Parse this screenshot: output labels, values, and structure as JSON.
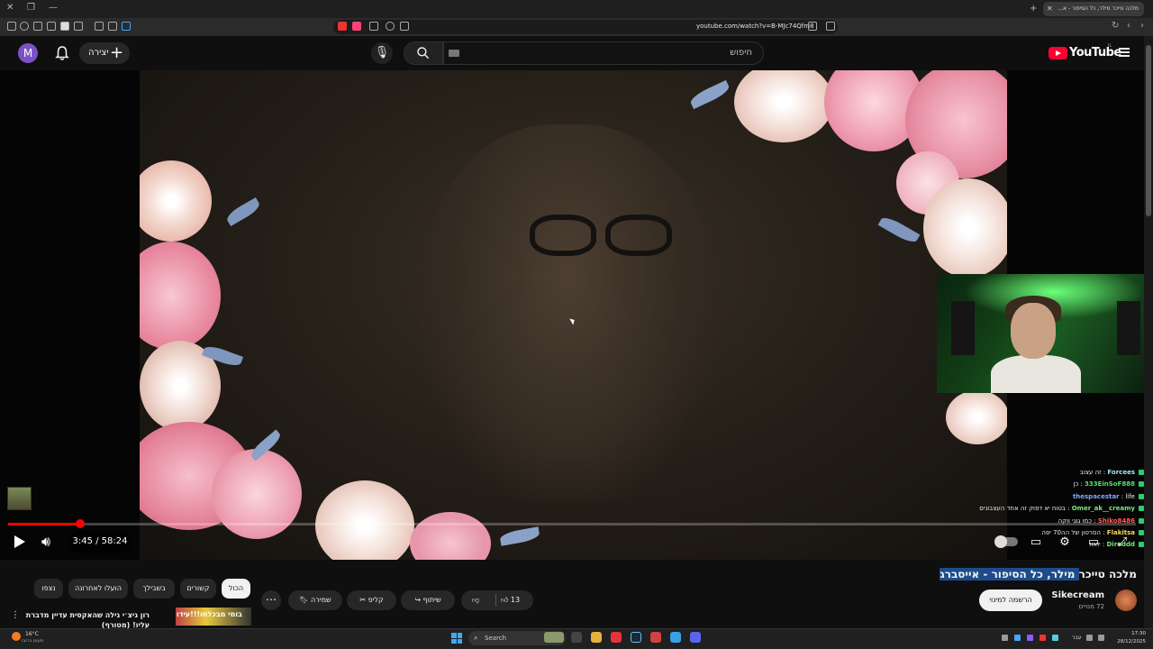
{
  "browser": {
    "active_tab_title": "מלכה טייכר מילר, כל הסיפור - א...",
    "url": "youtube.com/watch?v=B-MJc74Qfm8"
  },
  "header": {
    "avatar_letter": "M",
    "create_label": "יצירה",
    "search_placeholder": "חיפוש",
    "logo_text": "YouTube",
    "logo_country": "IL"
  },
  "player": {
    "time": "3:45 / 58:24",
    "progress": 0.064,
    "chat": [
      {
        "user": "Forcees",
        "message": "זה עצוב"
      },
      {
        "user": "333EinSoF888",
        "message": "כן"
      },
      {
        "user": "thespacestar",
        "message": "life"
      },
      {
        "user": "Omer_ak__creamy",
        "message": "בטוח יא דפוק זה אחד העצבונים"
      },
      {
        "user": "Shiko8486",
        "message": "כמו גוגי ווקה"
      },
      {
        "user": "Flakitsa",
        "message": "הסרטון של הה70 יפה"
      },
      {
        "user": "Diroddd",
        "message": "יואוו"
      }
    ]
  },
  "video": {
    "title_prefix": "מלכה טייכר",
    "title_highlight": " מילר, כל הסיפור - אייסברג",
    "channel_name": "Sikecream",
    "subscribers": "72 מנויים",
    "subscribe_label": "הרשמה למינוי",
    "like_count": "13",
    "share_label": "שיתוף",
    "clip_label": "קליפ",
    "save_label": "שמירה"
  },
  "chips": [
    "הכול",
    "קשורים",
    "בשבילך",
    "הועלו לאחרונה",
    "נצפו"
  ],
  "recommendation": {
    "thumb_text": "בומי מבכלחו!!!עידו",
    "title": "רון גיצ׳י גילה שהאקסית עדיין מדברת עליו! (מטורף)"
  },
  "taskbar": {
    "temperature": "16°C",
    "weather_desc": "מעונן ברובו",
    "search_label": "Search",
    "language": "עבר",
    "time": "17:30",
    "date": "28/12/2025"
  }
}
